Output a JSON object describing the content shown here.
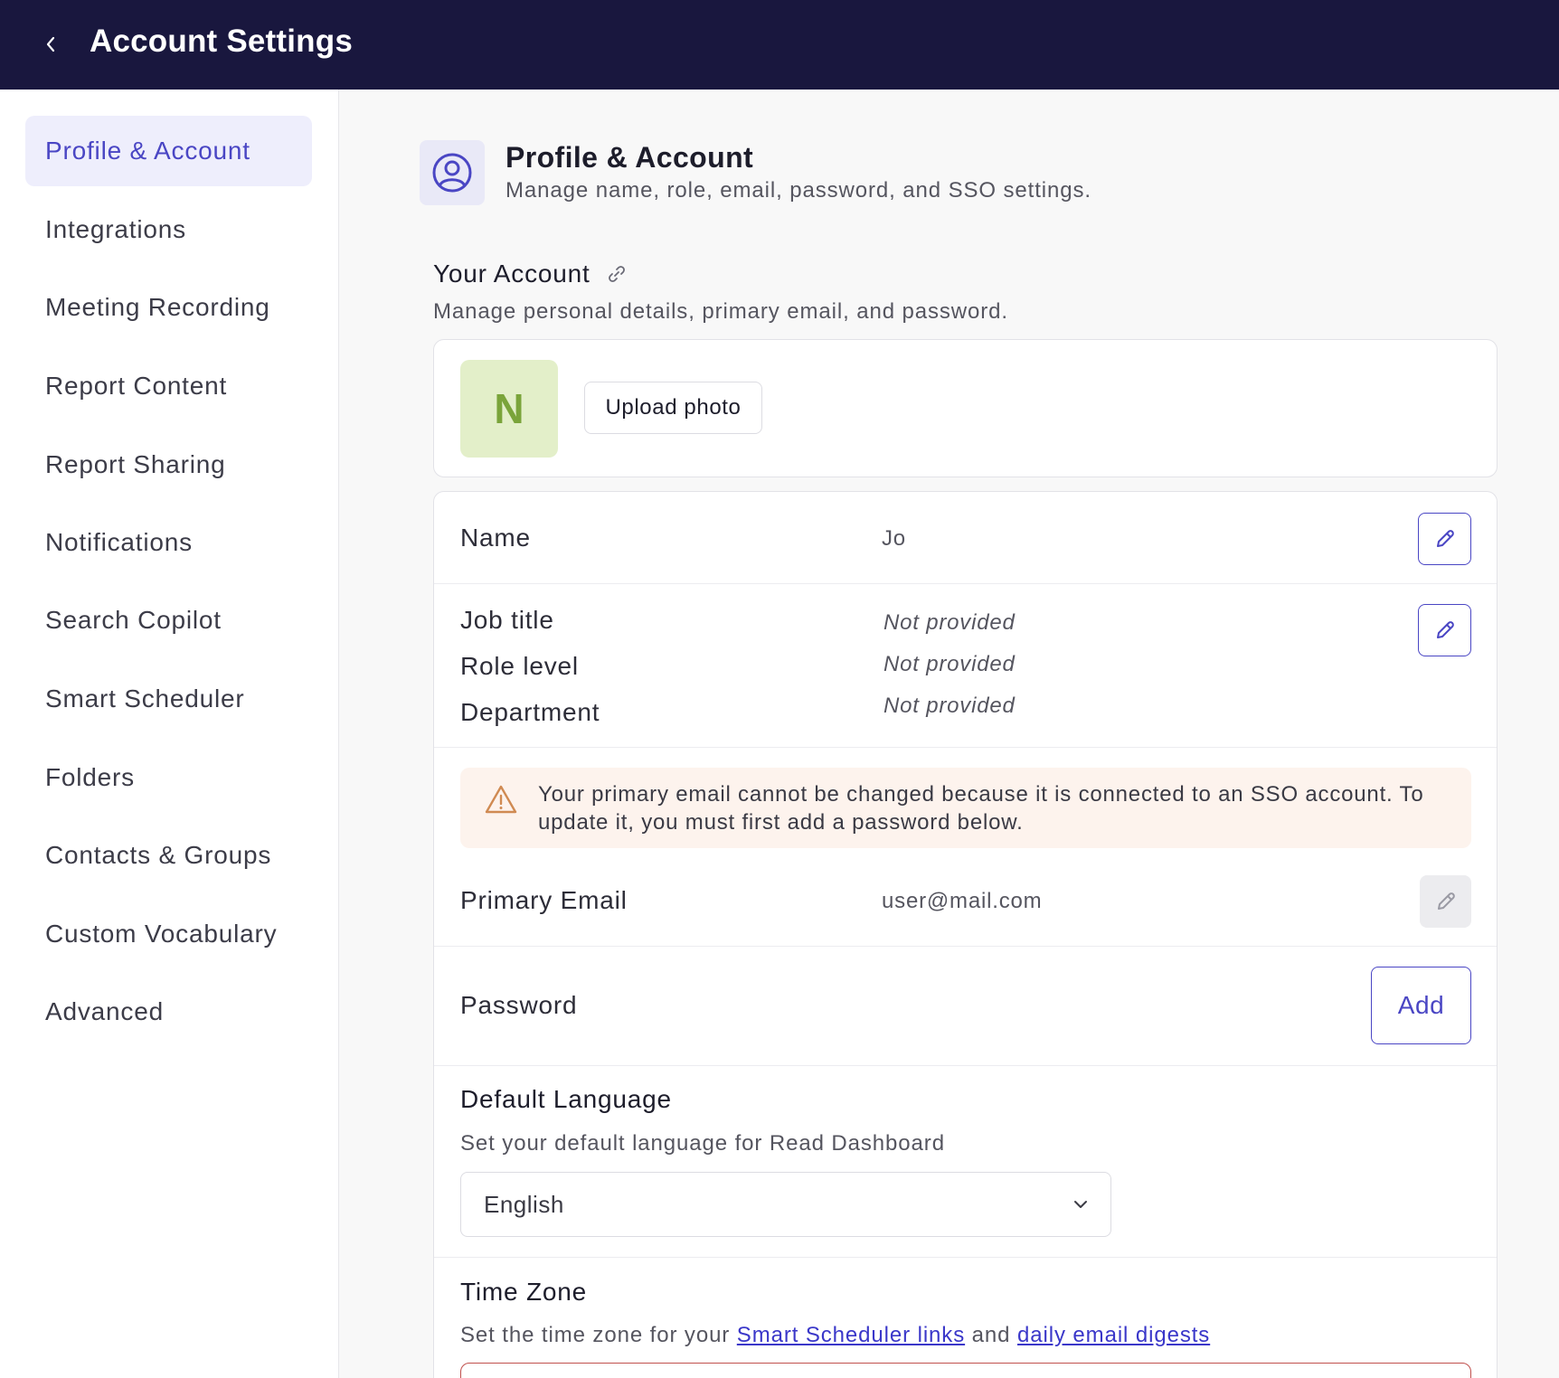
{
  "header": {
    "title": "Account Settings"
  },
  "sidebar": {
    "items": [
      {
        "label": "Profile & Account"
      },
      {
        "label": "Integrations"
      },
      {
        "label": "Meeting Recording"
      },
      {
        "label": "Report Content"
      },
      {
        "label": "Report Sharing"
      },
      {
        "label": "Notifications"
      },
      {
        "label": "Search Copilot"
      },
      {
        "label": "Smart Scheduler"
      },
      {
        "label": "Folders"
      },
      {
        "label": "Contacts & Groups"
      },
      {
        "label": "Custom Vocabulary"
      },
      {
        "label": "Advanced"
      }
    ],
    "active_index": 0
  },
  "section": {
    "title": "Profile & Account",
    "description": "Manage name, role, email, password, and SSO settings."
  },
  "account": {
    "title": "Your Account",
    "description": "Manage personal details, primary email, and password.",
    "avatar_initial": "N",
    "upload_label": "Upload photo",
    "name_label": "Name",
    "name_value": "Jo",
    "job_title_label": "Job title",
    "job_title_value": "Not provided",
    "role_level_label": "Role level",
    "role_level_value": "Not provided",
    "department_label": "Department",
    "department_value": "Not provided",
    "sso_warning": "Your primary email cannot be changed because it is connected to an SSO account. To update it, you must first add a password below.",
    "email_label": "Primary Email",
    "email_value": "user@mail.com",
    "password_label": "Password",
    "password_add_label": "Add"
  },
  "language": {
    "title": "Default Language",
    "description": "Set your default language for Read Dashboard",
    "selected": "English"
  },
  "timezone": {
    "title": "Time Zone",
    "desc_prefix": "Set the time zone for your ",
    "link1": "Smart Scheduler links",
    "desc_mid": " and ",
    "link2": "daily email digests"
  },
  "colors": {
    "topbar": "#19173e",
    "accent": "#4a46c4",
    "active_nav_bg": "#eeeefc",
    "avatar_bg": "#e3efc9",
    "avatar_fg": "#7aa43a",
    "warning_bg": "#fdf3ed",
    "warning_icon": "#d08a52",
    "error_border": "#c0504d"
  },
  "icons": {
    "back": "chevron-left-icon",
    "section": "user-circle-icon",
    "permalink": "link-icon",
    "edit": "pencil-icon",
    "warning": "warning-triangle-icon",
    "dropdown": "chevron-down-icon"
  }
}
